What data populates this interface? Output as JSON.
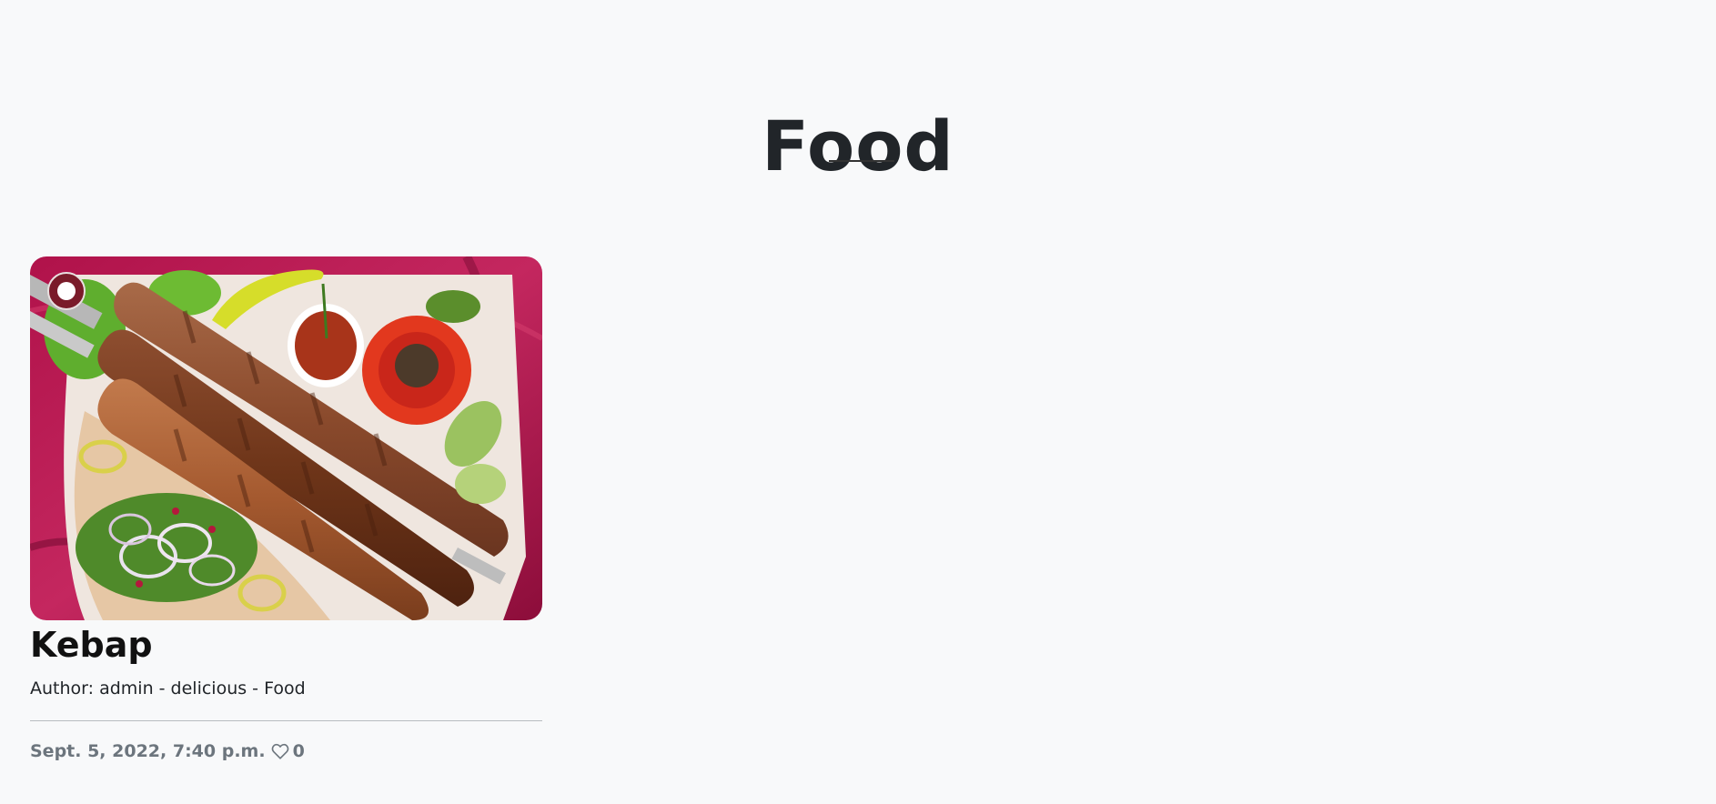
{
  "page": {
    "title": "Food"
  },
  "posts": [
    {
      "title": "Kebap",
      "meta": "Author: admin - delicious - Food",
      "date": "Sept. 5, 2022, 7:40 p.m.",
      "like_icon": "heart-icon",
      "likes": "0"
    }
  ],
  "colors": {
    "background": "#f8f9fa",
    "title": "#212529",
    "footer_text": "#6c757d"
  }
}
